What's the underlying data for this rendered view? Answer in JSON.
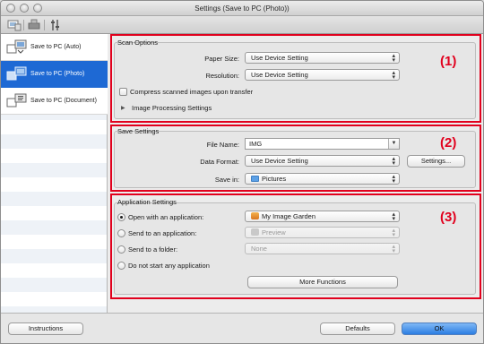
{
  "window": {
    "title": "Settings (Save to PC (Photo))"
  },
  "toolbar": {
    "tabs": [
      {
        "name": "scan-from-computer-tab",
        "icon": "scanner-icon"
      },
      {
        "name": "scan-from-panel-tab",
        "icon": "device-icon"
      },
      {
        "name": "general-settings-tab",
        "icon": "tools-icon"
      }
    ]
  },
  "sidebar": {
    "items": [
      {
        "label": "Save to PC (Auto)",
        "active": false
      },
      {
        "label": "Save to PC (Photo)",
        "active": true
      },
      {
        "label": "Save to PC (Document)",
        "active": false
      }
    ]
  },
  "scan_options": {
    "title": "Scan Options",
    "marker": "(1)",
    "paper_size_label": "Paper Size:",
    "paper_size_value": "Use Device Setting",
    "resolution_label": "Resolution:",
    "resolution_value": "Use Device Setting",
    "compress_label": "Compress scanned images upon transfer",
    "image_processing_label": "Image Processing Settings"
  },
  "save_settings": {
    "title": "Save Settings",
    "marker": "(2)",
    "file_name_label": "File Name:",
    "file_name_value": "IMG",
    "data_format_label": "Data Format:",
    "data_format_value": "Use Device Setting",
    "settings_button": "Settings...",
    "save_in_label": "Save in:",
    "save_in_value": "Pictures"
  },
  "application_settings": {
    "title": "Application Settings",
    "marker": "(3)",
    "open_with_label": "Open with an application:",
    "open_with_value": "My Image Garden",
    "send_to_app_label": "Send to an application:",
    "send_to_app_value": "Preview",
    "send_to_folder_label": "Send to a folder:",
    "send_to_folder_value": "None",
    "do_not_start_label": "Do not start any application",
    "more_functions_button": "More Functions"
  },
  "bottom": {
    "instructions_button": "Instructions",
    "defaults_button": "Defaults",
    "ok_button": "OK"
  },
  "colors": {
    "selection": "#1e69d4",
    "marker_red": "#e1001d",
    "default_button": "#2b7ee2"
  }
}
